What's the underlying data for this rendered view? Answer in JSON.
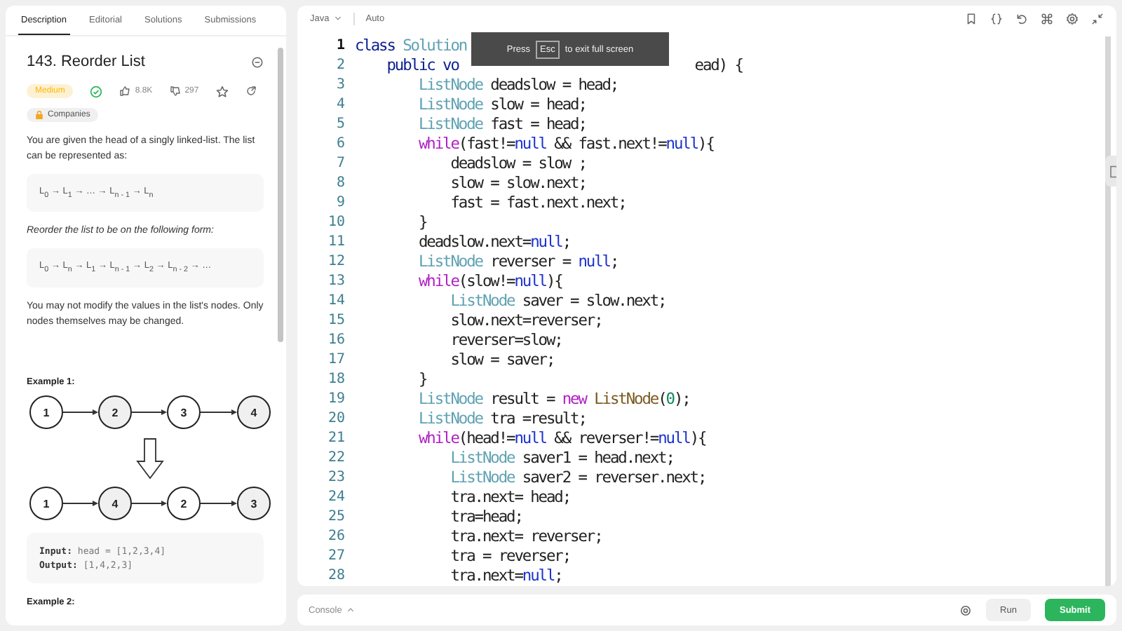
{
  "problem_panel": {
    "tabs": [
      {
        "label": "Description",
        "selected": true
      },
      {
        "label": "Editorial",
        "selected": false
      },
      {
        "label": "Solutions",
        "selected": false
      },
      {
        "label": "Submissions",
        "selected": false
      }
    ],
    "title": "143. Reorder List",
    "difficulty": "Medium",
    "solved": true,
    "likes": "8.8K",
    "dislikes": "297",
    "companies": "Companies",
    "intro": "You are given the head of a singly linked-list. The list can be represented as:",
    "formula_1": "L$_{0}$ → L$_{1}$ → … → L$_{n - 1}$ → L$_{n}$",
    "instruction": "Reorder the list to be on the following form:",
    "formula_2": "L$_{0}$ → L$_{n}$ → L$_{1}$ → L$_{n - 1}$ → L$_{2}$ → L$_{n - 2}$ → …",
    "note": "You may not modify the values in the list's nodes. Only nodes themselves may be changed.",
    "example_1": {
      "heading": "Example 1:",
      "before": [
        {
          "value": "1",
          "shaded": false
        },
        {
          "value": "2",
          "shaded": true
        },
        {
          "value": "3",
          "shaded": false
        },
        {
          "value": "4",
          "shaded": true
        }
      ],
      "after": [
        {
          "value": "1",
          "shaded": false
        },
        {
          "value": "4",
          "shaded": true
        },
        {
          "value": "2",
          "shaded": false
        },
        {
          "value": "3",
          "shaded": true
        }
      ],
      "input_label": "Input:",
      "input": "head = [1,2,3,4]",
      "output_label": "Output:",
      "output": "[1,4,2,3]"
    },
    "example_2": {
      "heading": "Example 2:"
    }
  },
  "editor": {
    "language": "Java",
    "mode": "Auto",
    "lines": [
      {
        "n": "1",
        "current": true,
        "tokens": [
          {
            "kind": "keyword",
            "text": "class"
          },
          {
            "kind": "type",
            "text": " Solution"
          }
        ]
      },
      {
        "n": "2",
        "current": false,
        "tokens": [
          {
            "kind": "keyword",
            "text": "    public"
          },
          {
            "kind": "keyword",
            "text": " vo"
          },
          {
            "kind": "covered"
          },
          {
            "kind": "plain",
            "text": "ead) {"
          }
        ]
      },
      {
        "n": "3",
        "current": false,
        "tokens": [
          {
            "kind": "type",
            "text": "        ListNode"
          },
          {
            "kind": "plain",
            "text": " deadslow = head;"
          }
        ]
      },
      {
        "n": "4",
        "current": false,
        "tokens": [
          {
            "kind": "type",
            "text": "        ListNode"
          },
          {
            "kind": "plain",
            "text": " slow = head;"
          }
        ]
      },
      {
        "n": "5",
        "current": false,
        "tokens": [
          {
            "kind": "type",
            "text": "        ListNode"
          },
          {
            "kind": "plain",
            "text": " fast = head;"
          }
        ]
      },
      {
        "n": "6",
        "current": false,
        "tokens": [
          {
            "kind": "control",
            "text": "        while"
          },
          {
            "kind": "plain",
            "text": "(fast!="
          },
          {
            "kind": "literal",
            "text": "null"
          },
          {
            "kind": "plain",
            "text": " && fast.next!="
          },
          {
            "kind": "literal",
            "text": "null"
          },
          {
            "kind": "plain",
            "text": "){"
          }
        ]
      },
      {
        "n": "7",
        "current": false,
        "tokens": [
          {
            "kind": "plain",
            "text": "            deadslow = slow ;"
          }
        ]
      },
      {
        "n": "8",
        "current": false,
        "tokens": [
          {
            "kind": "plain",
            "text": "            slow = slow.next;"
          }
        ]
      },
      {
        "n": "9",
        "current": false,
        "tokens": [
          {
            "kind": "plain",
            "text": "            fast = fast.next.next;"
          }
        ]
      },
      {
        "n": "10",
        "current": false,
        "tokens": [
          {
            "kind": "plain",
            "text": "        }"
          }
        ]
      },
      {
        "n": "11",
        "current": false,
        "tokens": [
          {
            "kind": "plain",
            "text": "        deadslow.next="
          },
          {
            "kind": "literal",
            "text": "null"
          },
          {
            "kind": "plain",
            "text": ";"
          }
        ]
      },
      {
        "n": "12",
        "current": false,
        "tokens": [
          {
            "kind": "type",
            "text": "        ListNode"
          },
          {
            "kind": "plain",
            "text": " reverser = "
          },
          {
            "kind": "literal",
            "text": "null"
          },
          {
            "kind": "plain",
            "text": ";"
          }
        ]
      },
      {
        "n": "13",
        "current": false,
        "tokens": [
          {
            "kind": "control",
            "text": "        while"
          },
          {
            "kind": "plain",
            "text": "(slow!="
          },
          {
            "kind": "literal",
            "text": "null"
          },
          {
            "kind": "plain",
            "text": "){"
          }
        ]
      },
      {
        "n": "14",
        "current": false,
        "tokens": [
          {
            "kind": "type",
            "text": "            ListNode"
          },
          {
            "kind": "plain",
            "text": " saver = slow.next;"
          }
        ]
      },
      {
        "n": "15",
        "current": false,
        "tokens": [
          {
            "kind": "plain",
            "text": "            slow.next=reverser;"
          }
        ]
      },
      {
        "n": "16",
        "current": false,
        "tokens": [
          {
            "kind": "plain",
            "text": "            reverser=slow;"
          }
        ]
      },
      {
        "n": "17",
        "current": false,
        "tokens": [
          {
            "kind": "plain",
            "text": "            slow = saver;"
          }
        ]
      },
      {
        "n": "18",
        "current": false,
        "tokens": [
          {
            "kind": "plain",
            "text": "        }"
          }
        ]
      },
      {
        "n": "19",
        "current": false,
        "tokens": [
          {
            "kind": "type",
            "text": "        ListNode"
          },
          {
            "kind": "plain",
            "text": " result = "
          },
          {
            "kind": "control",
            "text": "new"
          },
          {
            "kind": "function",
            "text": " ListNode"
          },
          {
            "kind": "plain",
            "text": "("
          },
          {
            "kind": "number",
            "text": "0"
          },
          {
            "kind": "plain",
            "text": ");"
          }
        ]
      },
      {
        "n": "20",
        "current": false,
        "tokens": [
          {
            "kind": "type",
            "text": "        ListNode"
          },
          {
            "kind": "plain",
            "text": " tra =result;"
          }
        ]
      },
      {
        "n": "21",
        "current": false,
        "tokens": [
          {
            "kind": "control",
            "text": "        while"
          },
          {
            "kind": "plain",
            "text": "(head!="
          },
          {
            "kind": "literal",
            "text": "null"
          },
          {
            "kind": "plain",
            "text": " && reverser!="
          },
          {
            "kind": "literal",
            "text": "null"
          },
          {
            "kind": "plain",
            "text": "){"
          }
        ]
      },
      {
        "n": "22",
        "current": false,
        "tokens": [
          {
            "kind": "type",
            "text": "            ListNode"
          },
          {
            "kind": "plain",
            "text": " saver1 = head.next;"
          }
        ]
      },
      {
        "n": "23",
        "current": false,
        "tokens": [
          {
            "kind": "type",
            "text": "            ListNode"
          },
          {
            "kind": "plain",
            "text": " saver2 = reverser.next;"
          }
        ]
      },
      {
        "n": "24",
        "current": false,
        "tokens": [
          {
            "kind": "plain",
            "text": "            tra.next= head;"
          }
        ]
      },
      {
        "n": "25",
        "current": false,
        "tokens": [
          {
            "kind": "plain",
            "text": "            tra=head;"
          }
        ]
      },
      {
        "n": "26",
        "current": false,
        "tokens": [
          {
            "kind": "plain",
            "text": "            tra.next= reverser;"
          }
        ]
      },
      {
        "n": "27",
        "current": false,
        "tokens": [
          {
            "kind": "plain",
            "text": "            tra = reverser;"
          }
        ]
      },
      {
        "n": "28",
        "current": false,
        "tokens": [
          {
            "kind": "plain",
            "text": "            tra.next="
          },
          {
            "kind": "literal",
            "text": "null"
          },
          {
            "kind": "plain",
            "text": ";"
          }
        ]
      }
    ],
    "fullscreen_notice": {
      "before": "Press",
      "key": "Esc",
      "after": "to exit full screen"
    }
  },
  "console_bar": {
    "label": "Console",
    "run": "Run",
    "submit": "Submit"
  }
}
